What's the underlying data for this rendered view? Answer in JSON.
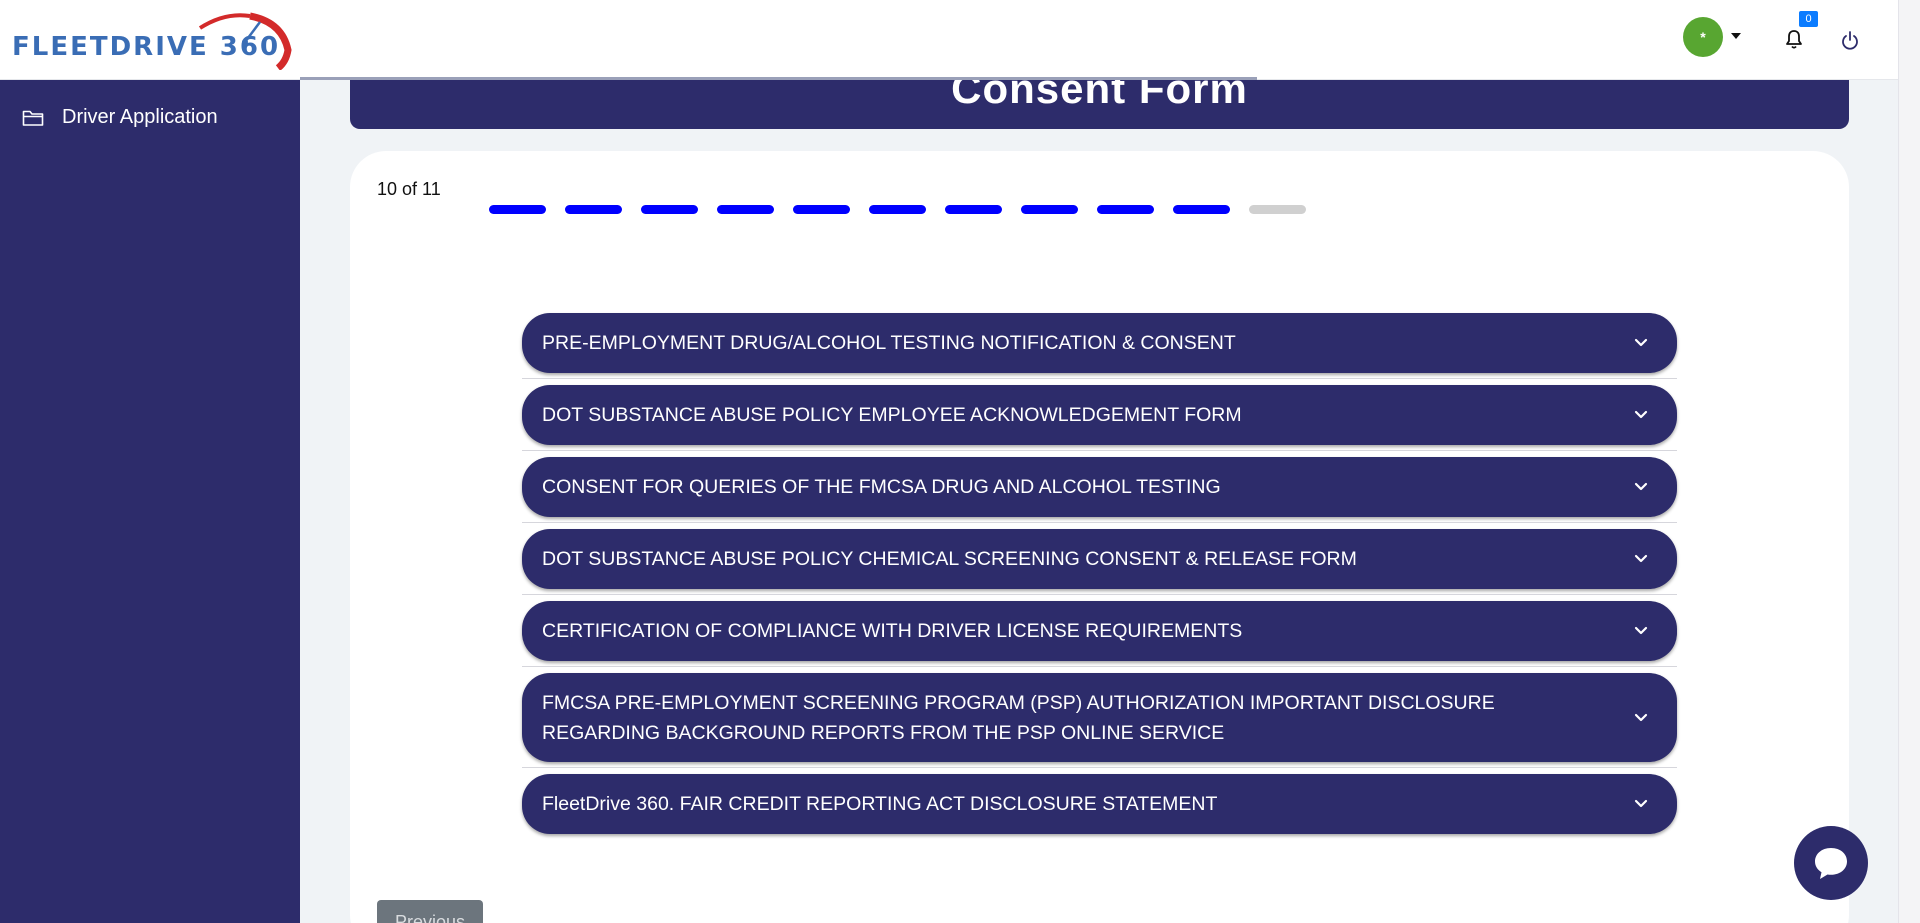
{
  "brand": {
    "logo_text": "FLEETDRIVE 360",
    "primary_color": "#2d2c6b",
    "logo_blue": "#3a6db5",
    "logo_red": "#d32a2a"
  },
  "header": {
    "avatar_initial": "*",
    "notifications_count": "0"
  },
  "sidebar": {
    "items": [
      {
        "label": "Driver Application",
        "icon": "folder-icon"
      }
    ]
  },
  "page": {
    "title": "Consent Form"
  },
  "progress": {
    "label": "10 of 11",
    "completed_steps": 10,
    "total_steps": 11,
    "active_color": "#0000ff",
    "pending_color": "#d0d0d0"
  },
  "accordion": {
    "items": [
      {
        "label": "PRE-EMPLOYMENT DRUG/ALCOHOL TESTING NOTIFICATION & CONSENT"
      },
      {
        "label": "DOT SUBSTANCE ABUSE POLICY EMPLOYEE ACKNOWLEDGEMENT FORM"
      },
      {
        "label": "CONSENT FOR QUERIES OF THE FMCSA DRUG AND ALCOHOL TESTING"
      },
      {
        "label": "DOT SUBSTANCE ABUSE POLICY CHEMICAL SCREENING CONSENT & RELEASE FORM"
      },
      {
        "label": "CERTIFICATION OF COMPLIANCE WITH DRIVER LICENSE REQUIREMENTS"
      },
      {
        "label": "FMCSA PRE-EMPLOYMENT SCREENING PROGRAM (PSP) AUTHORIZATION IMPORTANT DISCLOSURE REGARDING BACKGROUND REPORTS FROM THE PSP ONLINE SERVICE"
      },
      {
        "label": "FleetDrive 360. FAIR CREDIT REPORTING ACT DISCLOSURE STATEMENT"
      }
    ]
  },
  "footer": {
    "previous_label": "Previous"
  },
  "chat": {
    "icon": "chat-bubble-icon"
  }
}
